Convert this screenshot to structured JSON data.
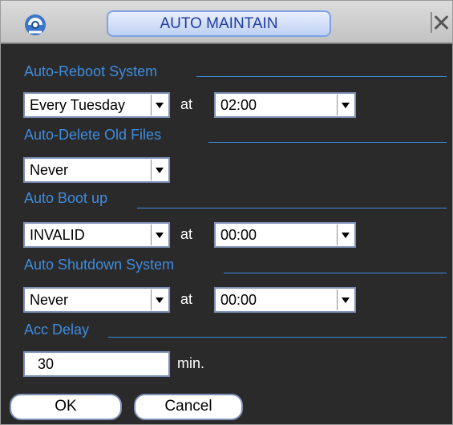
{
  "window": {
    "title": "AUTO MAINTAIN",
    "icon": "gear-icon",
    "close_icon": "close-icon"
  },
  "sections": [
    {
      "label": "Auto-Reboot System"
    },
    {
      "label": "Auto-Delete Old Files"
    },
    {
      "label": "Auto Boot up"
    },
    {
      "label": "Auto Shutdown System"
    },
    {
      "label": "Acc Delay"
    }
  ],
  "reboot": {
    "day": "Every Tuesday",
    "at": "at",
    "time": "02:00"
  },
  "delete_old_files": {
    "value": "Never"
  },
  "boot_up": {
    "value": "INVALID",
    "at": "at",
    "time": "00:00"
  },
  "shutdown": {
    "value": "Never",
    "at": "at",
    "time": "00:00"
  },
  "acc_delay": {
    "value": "30",
    "unit": "min."
  },
  "buttons": {
    "ok": "OK",
    "cancel": "Cancel"
  },
  "colors": {
    "label_blue": "#3f8cdf",
    "title_blue": "#1f3c9e",
    "background": "#2a2a2a",
    "field_border": "#7f8fb6"
  }
}
